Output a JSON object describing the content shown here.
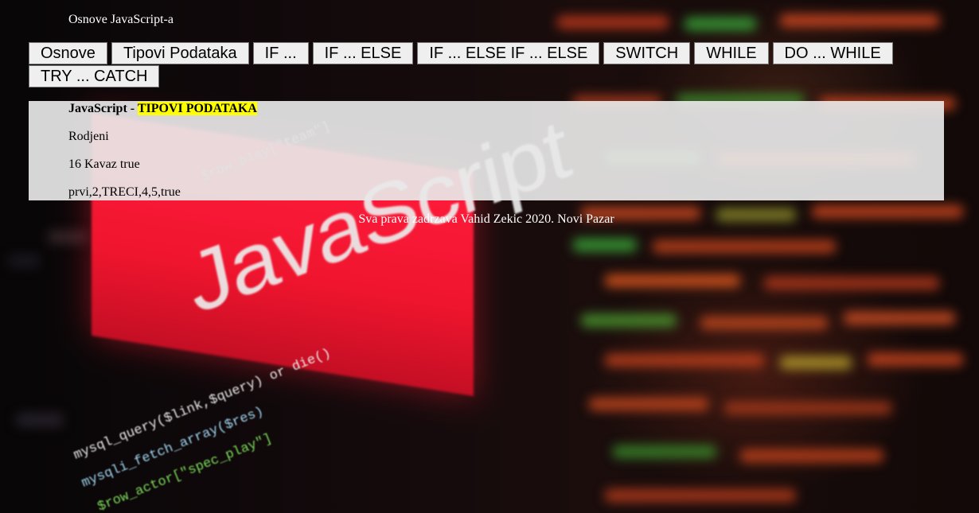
{
  "header": {
    "title": "Osnove JavaScript-a"
  },
  "nav": {
    "items": [
      {
        "label": "Osnove"
      },
      {
        "label": "Tipovi Podataka"
      },
      {
        "label": "IF ..."
      },
      {
        "label": "IF ... ELSE"
      },
      {
        "label": "IF ... ELSE IF ... ELSE"
      },
      {
        "label": "SWITCH"
      },
      {
        "label": "WHILE"
      },
      {
        "label": "DO ... WHILE"
      },
      {
        "label": "TRY ... CATCH"
      }
    ]
  },
  "content": {
    "title_prefix": "JavaScript - ",
    "title_highlight": "TIPOVI PODATAKA",
    "lines": [
      "Rodjeni",
      "16 Kavaz true",
      "prvi,2,TRECI,4,5,true"
    ]
  },
  "footer": {
    "text": "Sva prava zadrzava Vahid Zekic 2020. Novi Pazar"
  },
  "background": {
    "logo_text": "JavaScript",
    "icon": "javascript-code-background-image"
  },
  "colors": {
    "highlight": "#ffff00",
    "panel": "#e8e8e8",
    "logo_red": "#f0152e"
  }
}
